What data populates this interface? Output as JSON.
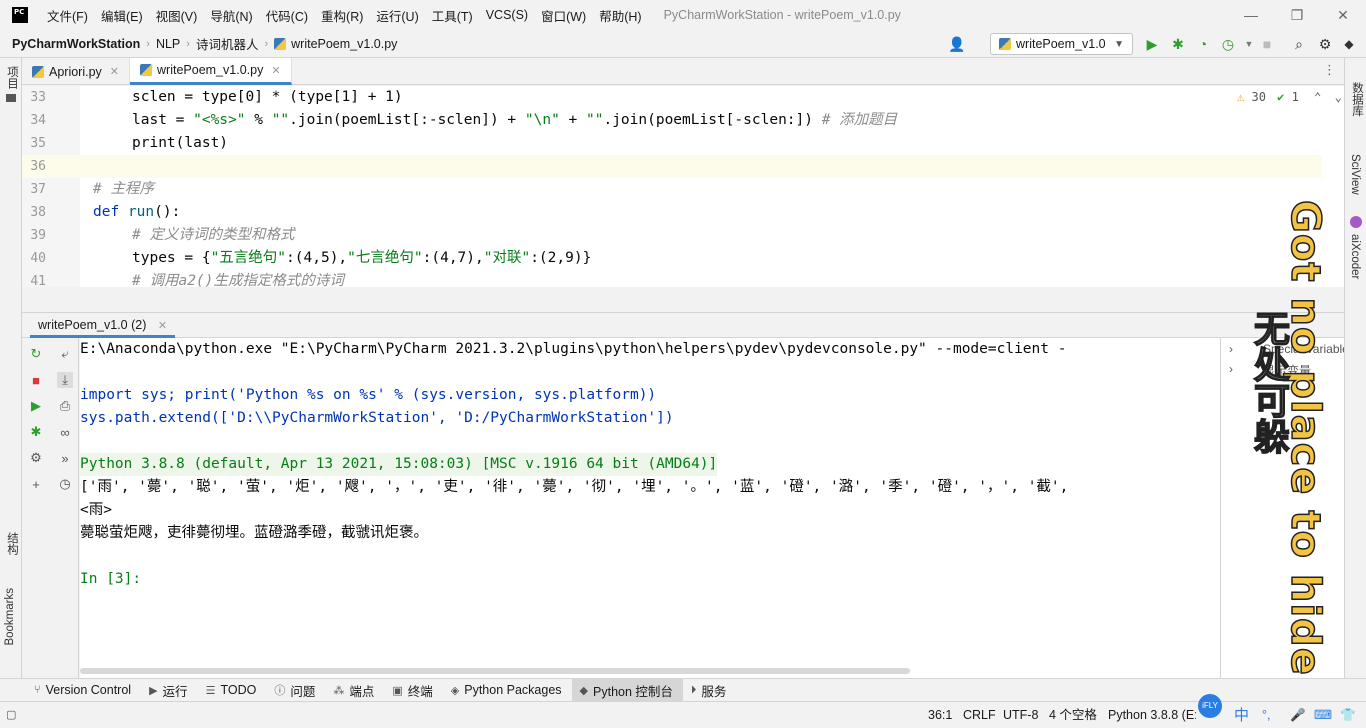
{
  "app": {
    "logo_text": "PC",
    "window_title": "PyCharmWorkStation - writePoem_v1.0.py",
    "menu": [
      "文件(F)",
      "编辑(E)",
      "视图(V)",
      "导航(N)",
      "代码(C)",
      "重构(R)",
      "运行(U)",
      "工具(T)",
      "VCS(S)",
      "窗口(W)",
      "帮助(H)"
    ]
  },
  "breadcrumb": [
    "PyCharmWorkStation",
    "NLP",
    "诗词机器人",
    "writePoem_v1.0.py"
  ],
  "run_config": {
    "label": "writePoem_v1.0"
  },
  "editor_tabs": [
    {
      "label": "Apriori.py",
      "active": false
    },
    {
      "label": "writePoem_v1.0.py",
      "active": true
    }
  ],
  "editor": {
    "line_numbers": [
      "33",
      "34",
      "35",
      "36",
      "37",
      "38",
      "39",
      "40",
      "41"
    ],
    "inspections": {
      "warnings": "30",
      "ok": "1"
    },
    "code": {
      "l33": "sclen = type[0] * (type[1] + 1)",
      "l34_a": "last = ",
      "l34_b": "\"<%s>\"",
      "l34_c": " % ",
      "l34_d": "\"\"",
      "l34_e": ".join(poemList[:-sclen]) + ",
      "l34_f": "\"\\n\"",
      "l34_g": " + ",
      "l34_h": "\"\"",
      "l34_i": ".join(poemList[-sclen:])",
      "l34_cmt": "# 添加题目",
      "l35": "print(last)",
      "l37_cmt": "# 主程序",
      "l38_kw": "def",
      "l38_fn": "run",
      "l38_rest": "():",
      "l39_cmt": "# 定义诗词的类型和格式",
      "l40_a": "types = {",
      "l40_s1": "\"五言绝句\"",
      "l40_t1": ":(4,5),",
      "l40_s2": "\"七言绝句\"",
      "l40_t2": ":(4,7),",
      "l40_s3": "\"对联\"",
      "l40_t3": ":(2,9)}",
      "l41_cmt": "# 调用a2()生成指定格式的诗词"
    }
  },
  "run_panel": {
    "tab_label": "writePoem_v1.0 (2)",
    "console_lines": [
      "E:\\Anaconda\\python.exe \"E:\\PyCharm\\PyCharm 2021.3.2\\plugins\\python\\helpers\\pydev\\pydevconsole.py\" --mode=client -",
      "",
      "import sys; print('Python %s on %s' % (sys.version, sys.platform))",
      "sys.path.extend(['D:\\\\PyCharmWorkStation', 'D:/PyCharmWorkStation'])",
      "",
      "Python 3.8.8 (default, Apr 13 2021, 15:08:03) [MSC v.1916 64 bit (AMD64)]",
      "['雨', '薨', '聪', '萤', '炬', '飕', '，', '吏', '徘', '薨', '彻', '埋', '。', '蓝', '磴', '潞', '季', '磴', '，', '截',",
      "<雨>",
      "薨聪萤炬飕，吏徘薨彻埋。蓝磴潞季磴，截虢讯炬褒。",
      "",
      "In [3]:"
    ],
    "vars": [
      "Special Variables",
      "显示变量"
    ]
  },
  "left_strip": [
    "项目",
    "结构",
    "Bookmarks"
  ],
  "right_strip": [
    "数据库",
    "SciView",
    "aiXcoder"
  ],
  "bottom_tools": [
    {
      "label": "Version Control",
      "icon": "branch-icon"
    },
    {
      "label": "运行",
      "icon": "play-icon"
    },
    {
      "label": "TODO",
      "icon": "list-icon"
    },
    {
      "label": "问题",
      "icon": "info-icon"
    },
    {
      "label": "端点",
      "icon": "package-icon"
    },
    {
      "label": "终端",
      "icon": "terminal-icon"
    },
    {
      "label": "Python Packages",
      "icon": "layers-icon"
    },
    {
      "label": "Python 控制台",
      "icon": "python-icon",
      "active": true
    },
    {
      "label": "服务",
      "icon": "play-circle-icon"
    }
  ],
  "status": {
    "position": "36:1",
    "line_sep": "CRLF",
    "encoding": "UTF-8",
    "indent": "4 个空格",
    "interpreter": "Python 3.8.8 (E:",
    "ime": "中"
  },
  "overlay": {
    "english": "Got no place to hide",
    "chinese": "无处可躲"
  }
}
